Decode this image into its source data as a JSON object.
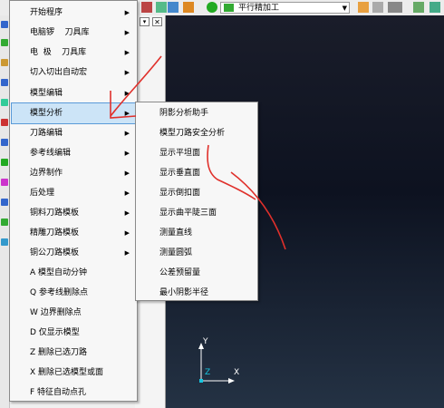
{
  "toolbar": {
    "strategy_value": "平行精加工",
    "icons": [
      "toolpath-icon",
      "layers-icon",
      "tool-icon",
      "dice-icon",
      "bucket-icon",
      "flip-icon",
      "green-swirl-icon",
      "list-icon",
      "wand-icon",
      "calculator-icon",
      "ruler-icon",
      "layout-icon",
      "transform-icon"
    ]
  },
  "main_menu": {
    "items": [
      {
        "label": "开始程序",
        "has_sub": true
      },
      {
        "label": "电脑锣    刀具库",
        "has_sub": true
      },
      {
        "label": "电  极    刀具库",
        "has_sub": true
      },
      {
        "label": "切入切出自动宏",
        "has_sub": true
      },
      {
        "label": "模型编辑",
        "has_sub": true
      },
      {
        "label": "模型分析",
        "has_sub": true,
        "active": true
      },
      {
        "label": "刀路编辑",
        "has_sub": true
      },
      {
        "label": "参考线编辑",
        "has_sub": true
      },
      {
        "label": "边界制作",
        "has_sub": true
      },
      {
        "label": "后处理",
        "has_sub": true
      },
      {
        "label": "铜料刀路模板",
        "has_sub": true
      },
      {
        "label": "精雕刀路模板",
        "has_sub": true
      },
      {
        "label": "铜公刀路模板",
        "has_sub": true
      },
      {
        "label": "A 模型自动分钟",
        "has_sub": false
      },
      {
        "label": "Q 参考线删除点",
        "has_sub": false
      },
      {
        "label": "W 边界删除点",
        "has_sub": false
      },
      {
        "label": "D 仅显示模型",
        "has_sub": false
      },
      {
        "label": "Z 删除已选刀路",
        "has_sub": false
      },
      {
        "label": "X 删除已选模型或面",
        "has_sub": false
      },
      {
        "label": "F 特征自动点孔",
        "has_sub": false
      }
    ]
  },
  "sub_menu": {
    "items": [
      {
        "label": "阴影分析助手"
      },
      {
        "label": "模型刀路安全分析"
      },
      {
        "label": "显示平坦面"
      },
      {
        "label": "显示垂直面"
      },
      {
        "label": "显示倒扣面"
      },
      {
        "label": "显示曲平陡三面"
      },
      {
        "label": "测量直线"
      },
      {
        "label": "测量圆弧"
      },
      {
        "label": "公差预留量"
      },
      {
        "label": "最小阴影半径"
      }
    ]
  },
  "axes": {
    "y": "Y",
    "x": "X",
    "z": "Z"
  },
  "colors": {
    "annotation": "#e0302b",
    "highlight": "#cce4f7",
    "viewport": "#111827"
  }
}
